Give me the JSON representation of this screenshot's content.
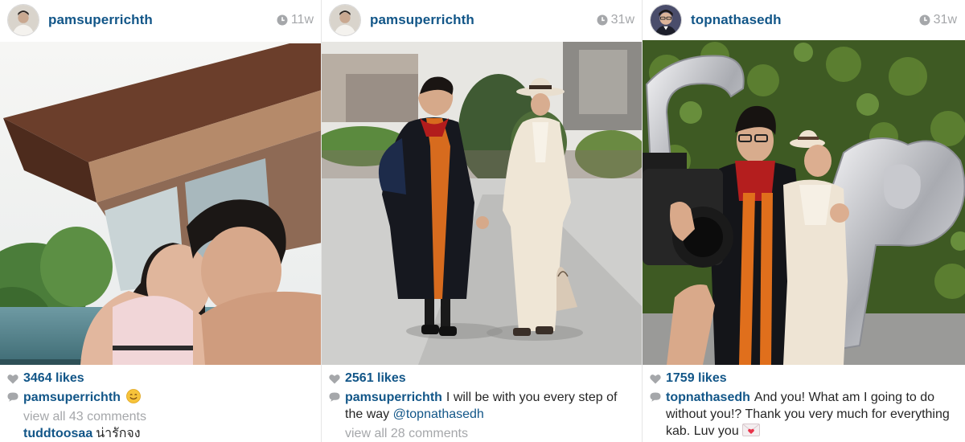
{
  "colors": {
    "link": "#125688",
    "muted": "#a5a7aa",
    "text": "#262626"
  },
  "posts": [
    {
      "username": "pamsuperrichth",
      "time": "11w",
      "likes": "3464 likes",
      "caption_user": "pamsuperrichth",
      "caption_text": "",
      "caption_emoji": "smile-emoji",
      "view_comments": "view all 43 comments",
      "comments": [
        {
          "user": "tuddtoosaa",
          "text": "น่ารักจง"
        }
      ]
    },
    {
      "username": "pamsuperrichth",
      "time": "31w",
      "likes": "2561 likes",
      "caption_user": "pamsuperrichth",
      "caption_text": "I will be with you every step of the way",
      "caption_mention": "@topnathasedh",
      "view_comments": "view all 28 comments"
    },
    {
      "username": "topnathasedh",
      "time": "31w",
      "likes": "1759 likes",
      "caption_user": "topnathasedh",
      "caption_text": "And you! What am I going to do without you!? Thank you very much for everything kab. Luv you",
      "caption_emoji": "love-letter-emoji"
    }
  ]
}
